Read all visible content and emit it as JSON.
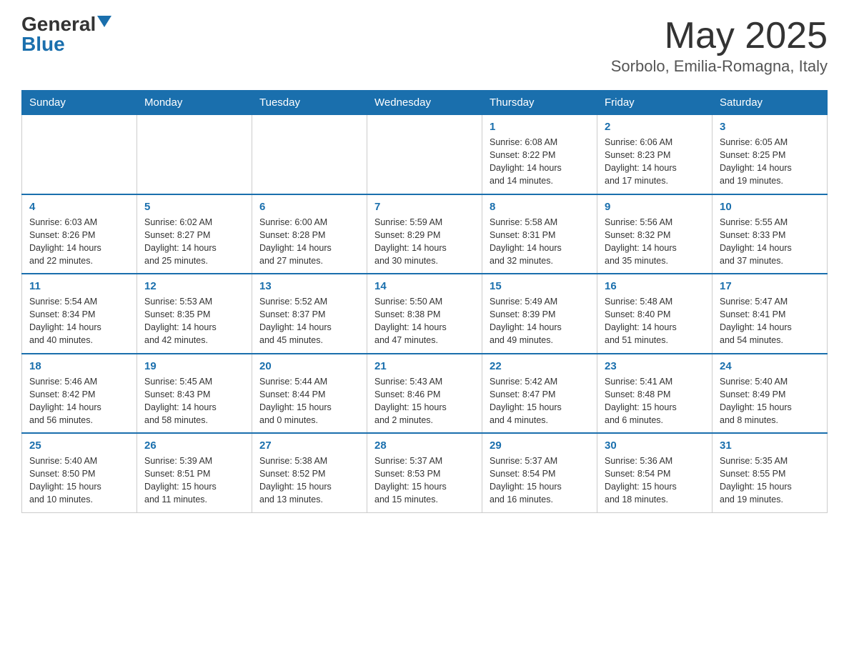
{
  "header": {
    "logo_general": "General",
    "logo_blue": "Blue",
    "title": "May 2025",
    "location": "Sorbolo, Emilia-Romagna, Italy"
  },
  "days_of_week": [
    "Sunday",
    "Monday",
    "Tuesday",
    "Wednesday",
    "Thursday",
    "Friday",
    "Saturday"
  ],
  "weeks": [
    [
      {
        "day": "",
        "info": ""
      },
      {
        "day": "",
        "info": ""
      },
      {
        "day": "",
        "info": ""
      },
      {
        "day": "",
        "info": ""
      },
      {
        "day": "1",
        "info": "Sunrise: 6:08 AM\nSunset: 8:22 PM\nDaylight: 14 hours\nand 14 minutes."
      },
      {
        "day": "2",
        "info": "Sunrise: 6:06 AM\nSunset: 8:23 PM\nDaylight: 14 hours\nand 17 minutes."
      },
      {
        "day": "3",
        "info": "Sunrise: 6:05 AM\nSunset: 8:25 PM\nDaylight: 14 hours\nand 19 minutes."
      }
    ],
    [
      {
        "day": "4",
        "info": "Sunrise: 6:03 AM\nSunset: 8:26 PM\nDaylight: 14 hours\nand 22 minutes."
      },
      {
        "day": "5",
        "info": "Sunrise: 6:02 AM\nSunset: 8:27 PM\nDaylight: 14 hours\nand 25 minutes."
      },
      {
        "day": "6",
        "info": "Sunrise: 6:00 AM\nSunset: 8:28 PM\nDaylight: 14 hours\nand 27 minutes."
      },
      {
        "day": "7",
        "info": "Sunrise: 5:59 AM\nSunset: 8:29 PM\nDaylight: 14 hours\nand 30 minutes."
      },
      {
        "day": "8",
        "info": "Sunrise: 5:58 AM\nSunset: 8:31 PM\nDaylight: 14 hours\nand 32 minutes."
      },
      {
        "day": "9",
        "info": "Sunrise: 5:56 AM\nSunset: 8:32 PM\nDaylight: 14 hours\nand 35 minutes."
      },
      {
        "day": "10",
        "info": "Sunrise: 5:55 AM\nSunset: 8:33 PM\nDaylight: 14 hours\nand 37 minutes."
      }
    ],
    [
      {
        "day": "11",
        "info": "Sunrise: 5:54 AM\nSunset: 8:34 PM\nDaylight: 14 hours\nand 40 minutes."
      },
      {
        "day": "12",
        "info": "Sunrise: 5:53 AM\nSunset: 8:35 PM\nDaylight: 14 hours\nand 42 minutes."
      },
      {
        "day": "13",
        "info": "Sunrise: 5:52 AM\nSunset: 8:37 PM\nDaylight: 14 hours\nand 45 minutes."
      },
      {
        "day": "14",
        "info": "Sunrise: 5:50 AM\nSunset: 8:38 PM\nDaylight: 14 hours\nand 47 minutes."
      },
      {
        "day": "15",
        "info": "Sunrise: 5:49 AM\nSunset: 8:39 PM\nDaylight: 14 hours\nand 49 minutes."
      },
      {
        "day": "16",
        "info": "Sunrise: 5:48 AM\nSunset: 8:40 PM\nDaylight: 14 hours\nand 51 minutes."
      },
      {
        "day": "17",
        "info": "Sunrise: 5:47 AM\nSunset: 8:41 PM\nDaylight: 14 hours\nand 54 minutes."
      }
    ],
    [
      {
        "day": "18",
        "info": "Sunrise: 5:46 AM\nSunset: 8:42 PM\nDaylight: 14 hours\nand 56 minutes."
      },
      {
        "day": "19",
        "info": "Sunrise: 5:45 AM\nSunset: 8:43 PM\nDaylight: 14 hours\nand 58 minutes."
      },
      {
        "day": "20",
        "info": "Sunrise: 5:44 AM\nSunset: 8:44 PM\nDaylight: 15 hours\nand 0 minutes."
      },
      {
        "day": "21",
        "info": "Sunrise: 5:43 AM\nSunset: 8:46 PM\nDaylight: 15 hours\nand 2 minutes."
      },
      {
        "day": "22",
        "info": "Sunrise: 5:42 AM\nSunset: 8:47 PM\nDaylight: 15 hours\nand 4 minutes."
      },
      {
        "day": "23",
        "info": "Sunrise: 5:41 AM\nSunset: 8:48 PM\nDaylight: 15 hours\nand 6 minutes."
      },
      {
        "day": "24",
        "info": "Sunrise: 5:40 AM\nSunset: 8:49 PM\nDaylight: 15 hours\nand 8 minutes."
      }
    ],
    [
      {
        "day": "25",
        "info": "Sunrise: 5:40 AM\nSunset: 8:50 PM\nDaylight: 15 hours\nand 10 minutes."
      },
      {
        "day": "26",
        "info": "Sunrise: 5:39 AM\nSunset: 8:51 PM\nDaylight: 15 hours\nand 11 minutes."
      },
      {
        "day": "27",
        "info": "Sunrise: 5:38 AM\nSunset: 8:52 PM\nDaylight: 15 hours\nand 13 minutes."
      },
      {
        "day": "28",
        "info": "Sunrise: 5:37 AM\nSunset: 8:53 PM\nDaylight: 15 hours\nand 15 minutes."
      },
      {
        "day": "29",
        "info": "Sunrise: 5:37 AM\nSunset: 8:54 PM\nDaylight: 15 hours\nand 16 minutes."
      },
      {
        "day": "30",
        "info": "Sunrise: 5:36 AM\nSunset: 8:54 PM\nDaylight: 15 hours\nand 18 minutes."
      },
      {
        "day": "31",
        "info": "Sunrise: 5:35 AM\nSunset: 8:55 PM\nDaylight: 15 hours\nand 19 minutes."
      }
    ]
  ]
}
